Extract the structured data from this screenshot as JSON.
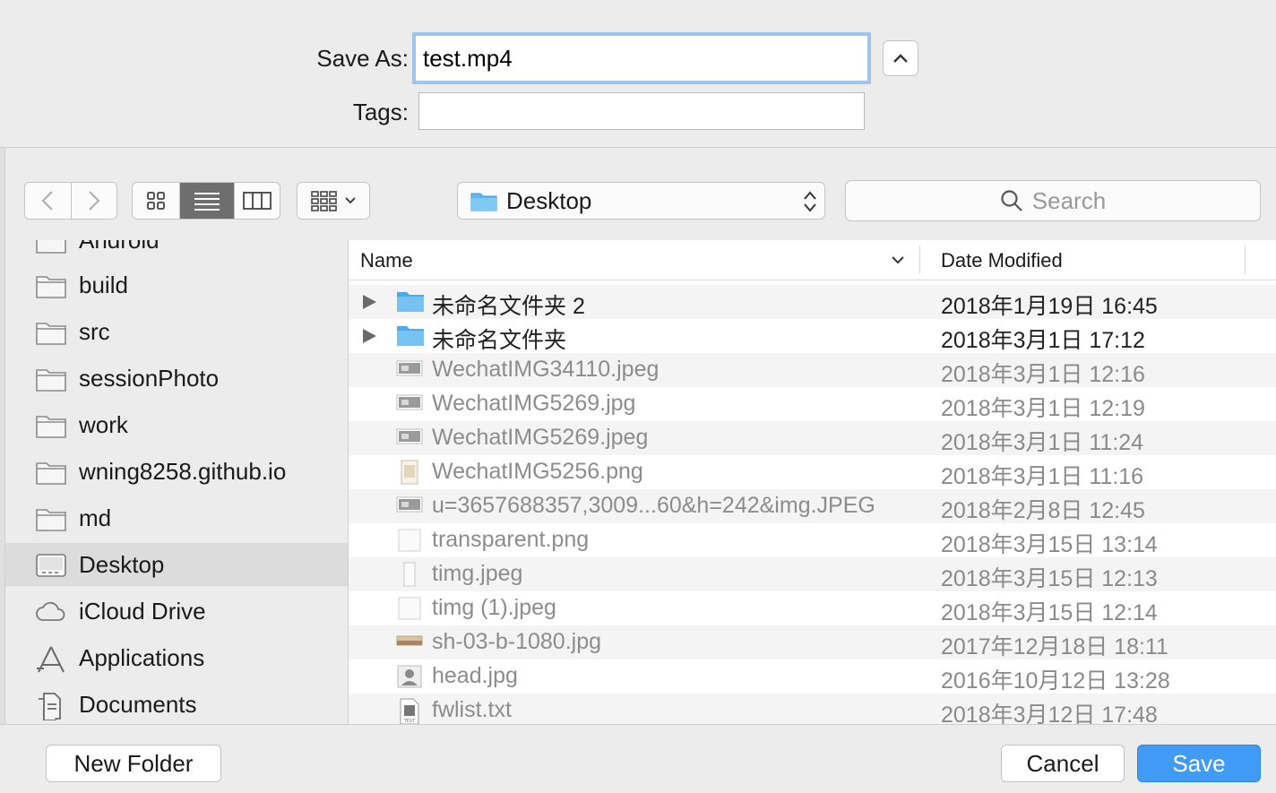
{
  "save_as": {
    "label": "Save As:",
    "value": "test.mp4"
  },
  "tags": {
    "label": "Tags:",
    "value": ""
  },
  "toolbar": {
    "back_icon": "chevron-left-icon",
    "forward_icon": "chevron-right-icon",
    "view_modes": [
      "icon-view",
      "list-view",
      "column-view"
    ],
    "active_view": "list-view",
    "location": "Desktop",
    "search_placeholder": "Search"
  },
  "sidebar": {
    "items": [
      {
        "label": "Android",
        "icon": "folder-icon"
      },
      {
        "label": "build",
        "icon": "folder-icon"
      },
      {
        "label": "src",
        "icon": "folder-icon"
      },
      {
        "label": "sessionPhoto",
        "icon": "folder-icon"
      },
      {
        "label": "work",
        "icon": "folder-icon"
      },
      {
        "label": "wning8258.github.io",
        "icon": "folder-icon"
      },
      {
        "label": "md",
        "icon": "folder-icon"
      },
      {
        "label": "Desktop",
        "icon": "desktop-icon",
        "selected": true
      },
      {
        "label": "iCloud Drive",
        "icon": "cloud-icon"
      },
      {
        "label": "Applications",
        "icon": "applications-icon"
      },
      {
        "label": "Documents",
        "icon": "documents-icon"
      }
    ]
  },
  "columns": {
    "name": "Name",
    "date": "Date Modified"
  },
  "files": [
    {
      "name": "未命名文件夹 2",
      "date": "2018年1月19日 16:45",
      "kind": "folder"
    },
    {
      "name": "未命名文件夹",
      "date": "2018年3月1日 17:12",
      "kind": "folder"
    },
    {
      "name": "WechatIMG34110.jpeg",
      "date": "2018年3月1日 12:16",
      "kind": "image"
    },
    {
      "name": "WechatIMG5269.jpg",
      "date": "2018年3月1日 12:19",
      "kind": "image"
    },
    {
      "name": "WechatIMG5269.jpeg",
      "date": "2018年3月1日 11:24",
      "kind": "image"
    },
    {
      "name": "WechatIMG5256.png",
      "date": "2018年3月1日 11:16",
      "kind": "image-portrait"
    },
    {
      "name": "u=3657688357,3009...60&h=242&img.JPEG",
      "date": "2018年2月8日 12:45",
      "kind": "image"
    },
    {
      "name": "transparent.png",
      "date": "2018年3月15日 13:14",
      "kind": "blank"
    },
    {
      "name": "timg.jpeg",
      "date": "2018年3月15日 12:13",
      "kind": "blank-portrait"
    },
    {
      "name": "timg (1).jpeg",
      "date": "2018年3月15日 12:14",
      "kind": "blank"
    },
    {
      "name": "sh-03-b-1080.jpg",
      "date": "2017年12月18日 18:11",
      "kind": "image-wide"
    },
    {
      "name": "head.jpg",
      "date": "2016年10月12日 13:28",
      "kind": "image-head"
    },
    {
      "name": "fwlist.txt",
      "date": "2018年3月12日 17:48",
      "kind": "text"
    }
  ],
  "buttons": {
    "new_folder": "New Folder",
    "cancel": "Cancel",
    "save": "Save"
  },
  "colors": {
    "accent": "#3f9bf6",
    "focus_ring": "#9fc4ef",
    "folder": "#5fb6f0"
  }
}
